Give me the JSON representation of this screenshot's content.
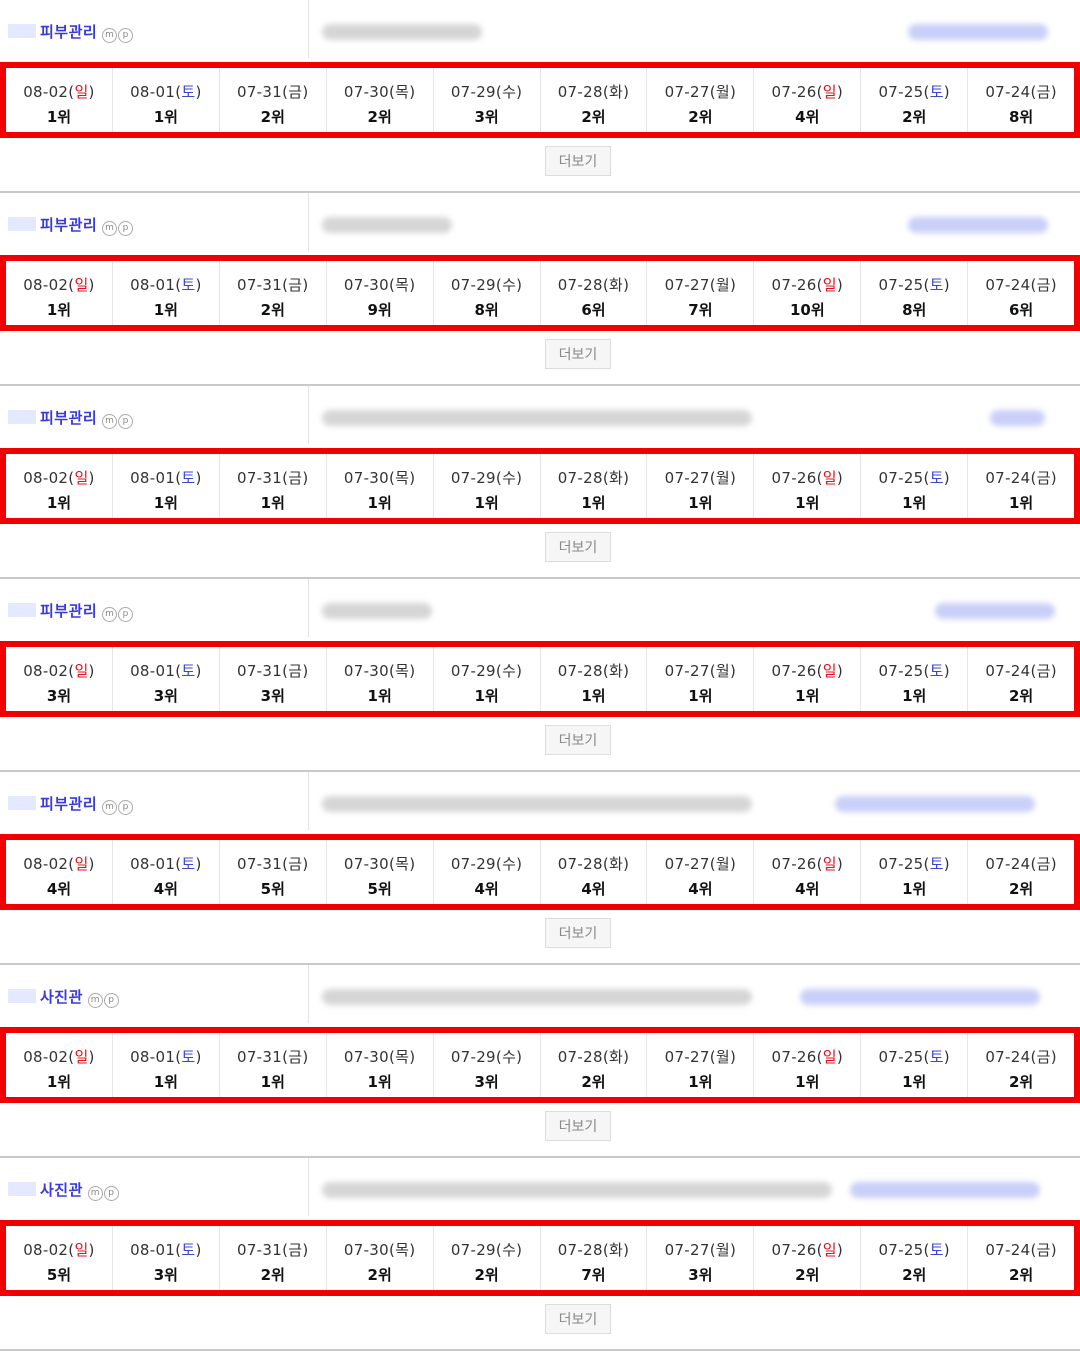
{
  "more_label": "더보기",
  "mp_icons": [
    "m",
    "p"
  ],
  "colors": {
    "highlight": "#f00000",
    "keyword": "#3a3adb",
    "sunday": "#e8101a",
    "saturday": "#3b47cf"
  },
  "dates": [
    {
      "date": "08-02",
      "day": "일",
      "day_type": "sun"
    },
    {
      "date": "08-01",
      "day": "토",
      "day_type": "sat"
    },
    {
      "date": "07-31",
      "day": "금",
      "day_type": "weekday"
    },
    {
      "date": "07-30",
      "day": "목",
      "day_type": "weekday"
    },
    {
      "date": "07-29",
      "day": "수",
      "day_type": "weekday"
    },
    {
      "date": "07-28",
      "day": "화",
      "day_type": "weekday"
    },
    {
      "date": "07-27",
      "day": "월",
      "day_type": "weekday"
    },
    {
      "date": "07-26",
      "day": "일",
      "day_type": "sun"
    },
    {
      "date": "07-25",
      "day": "토",
      "day_type": "sat"
    },
    {
      "date": "07-24",
      "day": "금",
      "day_type": "weekday"
    }
  ],
  "blocks": [
    {
      "keyword": "피부관리",
      "ranks": [
        "1위",
        "1위",
        "2위",
        "2위",
        "3위",
        "2위",
        "2위",
        "4위",
        "2위",
        "8위"
      ]
    },
    {
      "keyword": "피부관리",
      "ranks": [
        "1위",
        "1위",
        "2위",
        "9위",
        "8위",
        "6위",
        "7위",
        "10위",
        "8위",
        "6위"
      ]
    },
    {
      "keyword": "피부관리",
      "ranks": [
        "1위",
        "1위",
        "1위",
        "1위",
        "1위",
        "1위",
        "1위",
        "1위",
        "1위",
        "1위"
      ]
    },
    {
      "keyword": "피부관리",
      "ranks": [
        "3위",
        "3위",
        "3위",
        "1위",
        "1위",
        "1위",
        "1위",
        "1위",
        "1위",
        "2위"
      ]
    },
    {
      "keyword": "피부관리",
      "ranks": [
        "4위",
        "4위",
        "5위",
        "5위",
        "4위",
        "4위",
        "4위",
        "4위",
        "1위",
        "2위"
      ]
    },
    {
      "keyword": "사진관",
      "ranks": [
        "1위",
        "1위",
        "1위",
        "1위",
        "3위",
        "2위",
        "1위",
        "1위",
        "1위",
        "2위"
      ]
    },
    {
      "keyword": "사진관",
      "ranks": [
        "5위",
        "3위",
        "2위",
        "2위",
        "2위",
        "7위",
        "3위",
        "2위",
        "2위",
        "2위"
      ]
    }
  ]
}
